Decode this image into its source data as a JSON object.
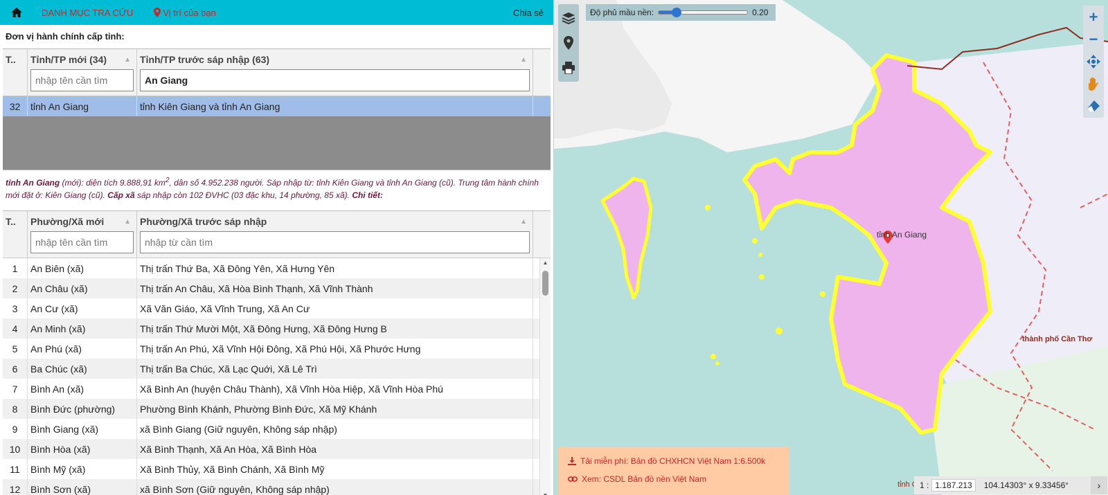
{
  "topbar": {
    "menu_label": "DANH MỤC TRA CỨU",
    "location_label": "Vị trí của bạn",
    "share_label": "Chia sẻ"
  },
  "province_section": {
    "title": "Đơn vị hành chính cấp tỉnh:",
    "columns": [
      "T..",
      "Tỉnh/TP mới (34)",
      "Tỉnh/TP trước sáp nhập (63)"
    ],
    "filter_new_placeholder": "nhập tên cần tìm",
    "filter_old_value": "An Giang",
    "rows": [
      {
        "no": "32",
        "new": "tỉnh An Giang",
        "old": "tỉnh Kiên Giang và tỉnh An Giang"
      }
    ]
  },
  "info": {
    "name": "tỉnh An Giang",
    "part1": " (mới): diện tích 9.888,91 km",
    "sup": "2",
    "part2": ", dân số 4.952.238 người. Sáp nhập từ: tỉnh Kiên Giang và tỉnh An Giang (cũ). Trung tâm hành chính mới đặt ở: Kiên Giang (cũ). ",
    "cap_xa": "Cấp xã",
    "part3": " sáp nhập còn 102 ĐVHC (03 đặc khu, 14 phường, 85 xã). ",
    "chi_tiet": "Chi tiết:"
  },
  "commune_section": {
    "columns": [
      "T..",
      "Phường/Xã mới",
      "Phường/Xã trước sáp nhập"
    ],
    "filter_new_placeholder": "nhập tên cần tìm",
    "filter_old_placeholder": "nhập từ cần tìm",
    "rows": [
      {
        "no": "1",
        "new": "An Biên (xã)",
        "old": "Thị trấn Thứ Ba, Xã Đông Yên, Xã Hưng Yên"
      },
      {
        "no": "2",
        "new": "An Châu (xã)",
        "old": "Thị trấn An Châu, Xã Hòa Bình Thạnh, Xã Vĩnh Thành"
      },
      {
        "no": "3",
        "new": "An Cư (xã)",
        "old": "Xã Văn Giáo, Xã Vĩnh Trung, Xã An Cư"
      },
      {
        "no": "4",
        "new": "An Minh (xã)",
        "old": "Thị trấn Thứ Mười Một, Xã Đông Hưng, Xã Đông Hưng B"
      },
      {
        "no": "5",
        "new": "An Phú (xã)",
        "old": "Thị trấn An Phú, Xã Vĩnh Hội Đông, Xã Phú Hội, Xã Phước Hưng"
      },
      {
        "no": "6",
        "new": "Ba Chúc (xã)",
        "old": "Thị trấn Ba Chúc, Xã Lạc Quới, Xã Lê Trì"
      },
      {
        "no": "7",
        "new": "Bình An (xã)",
        "old": "Xã Bình An (huyện Châu Thành), Xã Vĩnh Hòa Hiệp, Xã Vĩnh Hòa Phú"
      },
      {
        "no": "8",
        "new": "Bình Đức (phường)",
        "old": "Phường Bình Khánh, Phường Bình Đức, Xã Mỹ Khánh"
      },
      {
        "no": "9",
        "new": "Bình Giang (xã)",
        "old": "xã Bình Giang (Giữ nguyên, Không sáp nhập)"
      },
      {
        "no": "10",
        "new": "Bình Hòa (xã)",
        "old": "Xã Bình Thạnh, Xã An Hòa, Xã Bình Hòa"
      },
      {
        "no": "11",
        "new": "Bình Mỹ (xã)",
        "old": "Xã Bình Thủy, Xã Bình Chánh, Xã Bình Mỹ"
      },
      {
        "no": "12",
        "new": "Bình Sơn (xã)",
        "old": "xã Bình Sơn (Giữ nguyên, Không sáp nhập)"
      }
    ]
  },
  "map": {
    "opacity_label": "Độ phủ mầu nền:",
    "opacity_value": 0.2,
    "opacity_text": "0.20",
    "label_an_giang": "tỉnh An Giang",
    "label_can_tho": "thành phố Cần Thơ",
    "label_bottom": "tỉnh C",
    "download_label": "Tải miễn phí: Bản đồ CHXHCN Việt Nam 1:6.500k",
    "view_label": "Xem: CSDL Bản đồ nền Việt Nam",
    "scale_prefix": "1 :",
    "scale_value": "1.187.213",
    "coords": "104.14303° x 9.33456°",
    "colors": {
      "province_fill": "#f0b4ec",
      "province_border": "#ffff33",
      "sea": "#b7e0dc",
      "land": "#f2f2f2"
    }
  }
}
